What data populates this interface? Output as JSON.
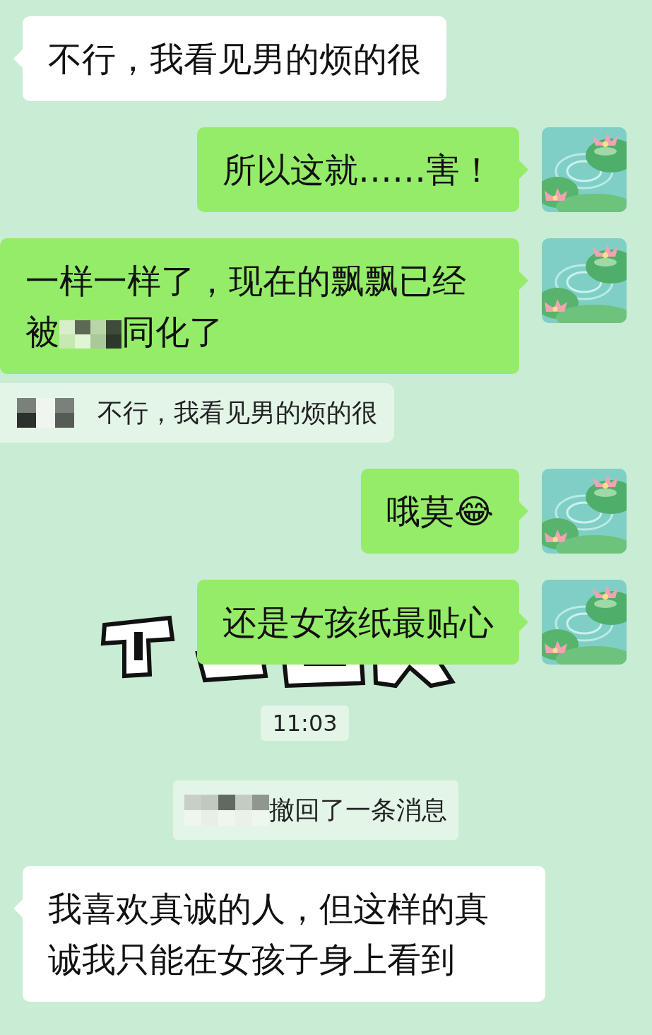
{
  "messages": [
    {
      "kind": "in",
      "parts": [
        {
          "text": "不行，我看见男的烦的很"
        }
      ]
    },
    {
      "kind": "out",
      "parts": [
        {
          "text": "所以这就……害！"
        }
      ]
    },
    {
      "kind": "out",
      "parts": [
        {
          "text": "一样一样了，现在的飘飘已经"
        },
        {
          "text": "被"
        },
        {
          "redacted": true
        },
        {
          "text": "同化了"
        }
      ]
    },
    {
      "kind": "quote",
      "parts": [
        {
          "redacted": true
        },
        {
          "text": "不行，我看见男的烦的很"
        }
      ]
    },
    {
      "kind": "out",
      "parts": [
        {
          "text": "哦莫😂"
        }
      ]
    },
    {
      "kind": "picture"
    },
    {
      "kind": "out",
      "parts": [
        {
          "text": "还是女孩纸最贴心"
        }
      ]
    },
    {
      "kind": "time",
      "parts": [
        {
          "text": "11:03"
        }
      ]
    },
    {
      "kind": "system",
      "parts": [
        {
          "redacted": true
        },
        {
          "text": "撤回了一条消息"
        }
      ]
    },
    {
      "kind": "in",
      "parts": [
        {
          "text": "我喜欢真诚的人，但这样的真诚我只能在女孩子身上看到"
        }
      ]
    }
  ]
}
